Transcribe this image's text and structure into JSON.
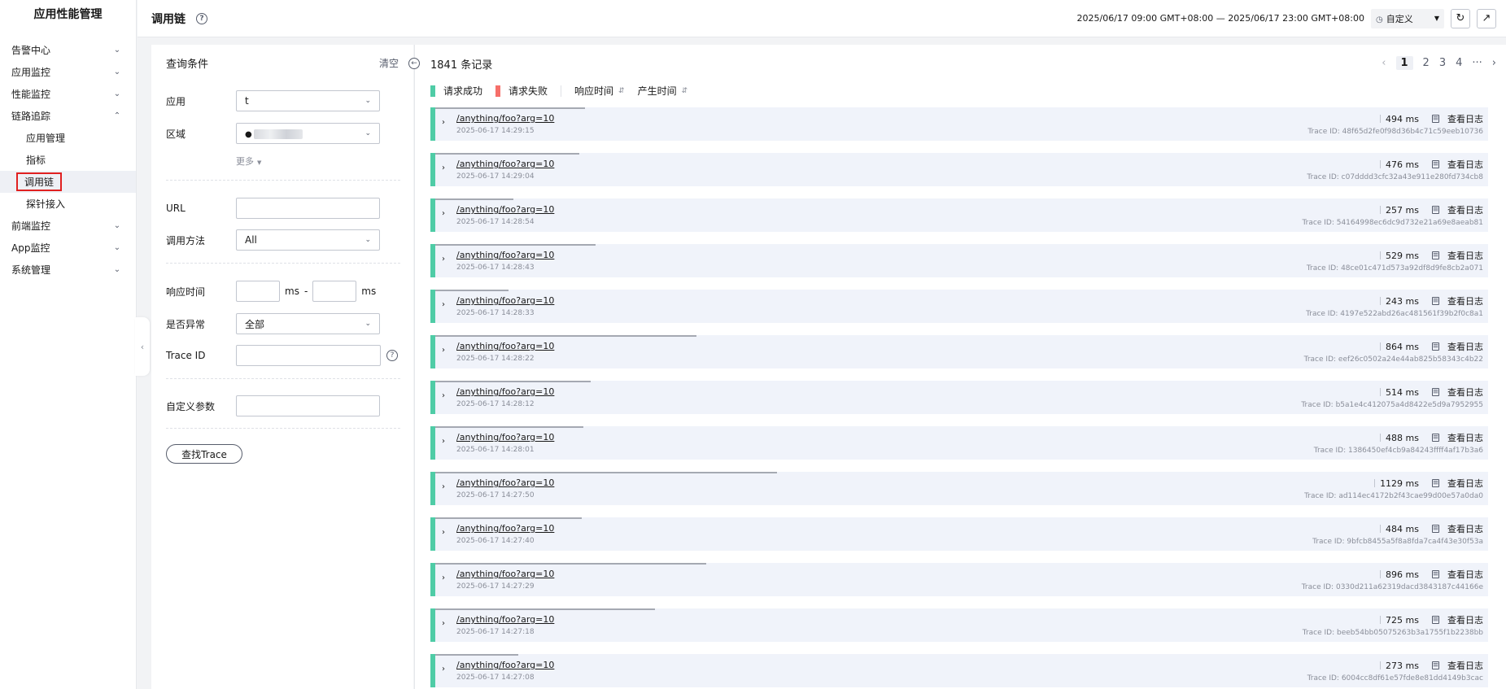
{
  "sidebar": {
    "title": "应用性能管理",
    "menu": [
      {
        "label": "告警中心",
        "icon": "chevron-down"
      },
      {
        "label": "应用监控",
        "icon": "chevron-down"
      },
      {
        "label": "性能监控",
        "icon": "chevron-down"
      },
      {
        "label": "链路追踪",
        "icon": "chevron-up"
      }
    ],
    "submenu": [
      "应用管理",
      "指标",
      "调用链",
      "探针接入"
    ],
    "menu2": [
      {
        "label": "前端监控",
        "icon": "chevron-down"
      },
      {
        "label": "App监控",
        "icon": "chevron-down"
      },
      {
        "label": "系统管理",
        "icon": "chevron-down"
      }
    ]
  },
  "header": {
    "title": "调用链",
    "time_range": "2025/06/17 09:00 GMT+08:00 — 2025/06/17 23:00 GMT+08:00",
    "time_mode": "自定义"
  },
  "query": {
    "title": "查询条件",
    "clear": "清空",
    "app_label": "应用",
    "app_value": "t",
    "region_label": "区域",
    "more": "更多",
    "url_label": "URL",
    "method_label": "调用方法",
    "method_value": "All",
    "resp_label": "响应时间",
    "ms": "ms",
    "dash": "-",
    "error_label": "是否异常",
    "error_value": "全部",
    "traceid_label": "Trace ID",
    "custom_label": "自定义参数",
    "search_btn": "查找Trace"
  },
  "results": {
    "count": "1841 条记录",
    "pages": [
      "1",
      "2",
      "3",
      "4",
      "···"
    ],
    "legend": {
      "success": "请求成功",
      "fail": "请求失败",
      "resp_time": "响应时间",
      "gen_time": "产生时间"
    },
    "success_color": "#4fcca6",
    "fail_color": "#f66f6a",
    "view_log": "查看日志",
    "trace_prefix": "Trace ID:",
    "rows": [
      {
        "url": "/anything/foo?arg=10",
        "time": "2025-06-17 14:29:15",
        "dur": "494 ms",
        "ms": 494,
        "trace": "48f65d2fe0f98d36b4c71c59eeb10736"
      },
      {
        "url": "/anything/foo?arg=10",
        "time": "2025-06-17 14:29:04",
        "dur": "476 ms",
        "ms": 476,
        "trace": "c07dddd3cfc32a43e911e280fd734cb8"
      },
      {
        "url": "/anything/foo?arg=10",
        "time": "2025-06-17 14:28:54",
        "dur": "257 ms",
        "ms": 257,
        "trace": "54164998ec6dc9d732e21a69e8aeab81"
      },
      {
        "url": "/anything/foo?arg=10",
        "time": "2025-06-17 14:28:43",
        "dur": "529 ms",
        "ms": 529,
        "trace": "48ce01c471d573a92df8d9fe8cb2a071"
      },
      {
        "url": "/anything/foo?arg=10",
        "time": "2025-06-17 14:28:33",
        "dur": "243 ms",
        "ms": 243,
        "trace": "4197e522abd26ac481561f39b2f0c8a1"
      },
      {
        "url": "/anything/foo?arg=10",
        "time": "2025-06-17 14:28:22",
        "dur": "864 ms",
        "ms": 864,
        "trace": "eef26c0502a24e44ab825b58343c4b22"
      },
      {
        "url": "/anything/foo?arg=10",
        "time": "2025-06-17 14:28:12",
        "dur": "514 ms",
        "ms": 514,
        "trace": "b5a1e4c412075a4d8422e5d9a7952955"
      },
      {
        "url": "/anything/foo?arg=10",
        "time": "2025-06-17 14:28:01",
        "dur": "488 ms",
        "ms": 488,
        "trace": "1386450ef4cb9a84243ffff4af17b3a6"
      },
      {
        "url": "/anything/foo?arg=10",
        "time": "2025-06-17 14:27:50",
        "dur": "1129 ms",
        "ms": 1129,
        "trace": "ad114ec4172b2f43cae99d00e57a0da0"
      },
      {
        "url": "/anything/foo?arg=10",
        "time": "2025-06-17 14:27:40",
        "dur": "484 ms",
        "ms": 484,
        "trace": "9bfcb8455a5f8a8fda7ca4f43e30f53a"
      },
      {
        "url": "/anything/foo?arg=10",
        "time": "2025-06-17 14:27:29",
        "dur": "896 ms",
        "ms": 896,
        "trace": "0330d211a62319dacd3843187c44166e"
      },
      {
        "url": "/anything/foo?arg=10",
        "time": "2025-06-17 14:27:18",
        "dur": "725 ms",
        "ms": 725,
        "trace": "beeb54bb05075263b3a1755f1b2238bb"
      },
      {
        "url": "/anything/foo?arg=10",
        "time": "2025-06-17 14:27:08",
        "dur": "273 ms",
        "ms": 273,
        "trace": "6004cc8df61e57fde8e81dd4149b3cac"
      }
    ]
  }
}
